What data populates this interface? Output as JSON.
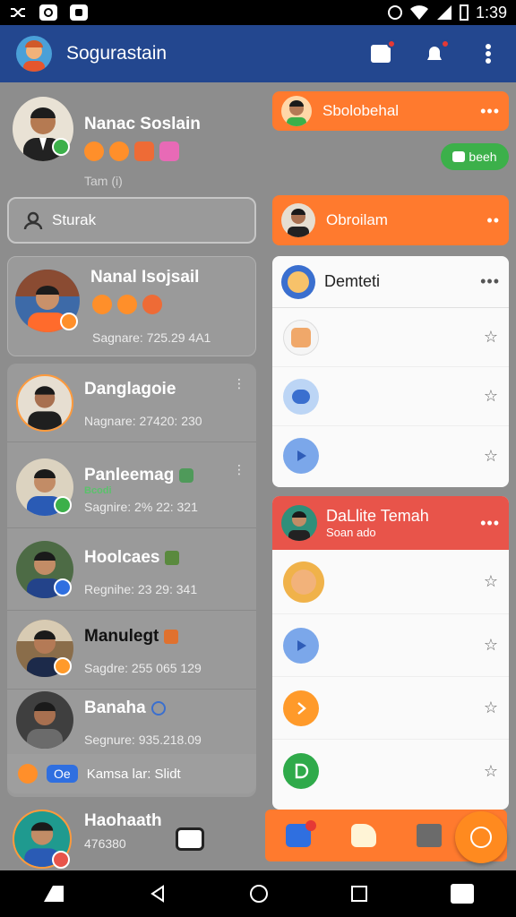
{
  "status_bar": {
    "time": "1:39",
    "icons": [
      "shuffle-icon",
      "circle-app-icon",
      "camera-app-icon",
      "alarm-icon",
      "wifi-icon",
      "signal-icon",
      "battery-icon"
    ]
  },
  "app_bar": {
    "title": "Sogurastain",
    "actions": [
      "compose-icon",
      "notification-bell-icon",
      "more-vert-icon"
    ]
  },
  "profile": {
    "name": "Nanac Soslain",
    "subtitle": "Tam (i)"
  },
  "search": {
    "placeholder": "Sturak"
  },
  "featured": {
    "name": "Nanal Isojsail",
    "subtitle": "Sagnare: 725.29 4A1"
  },
  "contacts": [
    {
      "name": "Danglagoie",
      "subtitle": "Nagnare: 27420: 230",
      "badge": ""
    },
    {
      "name": "Panleemag",
      "subtitle": "Sagnire: 2% 22: 321",
      "badge": "Bcodi"
    },
    {
      "name": "Hoolcaes",
      "subtitle": "Regnihe: 23 29: 341",
      "badge": ""
    },
    {
      "name": "Manulegt",
      "subtitle": "Sagdre: 255 065 129",
      "badge": ""
    },
    {
      "name": "Banaha",
      "subtitle": "Segnure: 935.218.09",
      "badge": ""
    }
  ],
  "left_footer_row": {
    "pill": "Oe",
    "text": "Kamsa lar: Slidt"
  },
  "bottom_left": {
    "name": "Haohaath",
    "subtitle": "476380"
  },
  "right_panel": {
    "top_card_title": "Sbolobehal",
    "green_button": "beeh",
    "second_card_title": "Obroilam",
    "list_title": "Demteti",
    "red_card_title": "DaLlite Temah",
    "red_card_subtitle": "Soan ado"
  },
  "colors": {
    "app_bar": "#23478f",
    "accent_orange": "#ff7a2e",
    "accent_red": "#e8544a",
    "accent_green": "#3cb04a"
  }
}
